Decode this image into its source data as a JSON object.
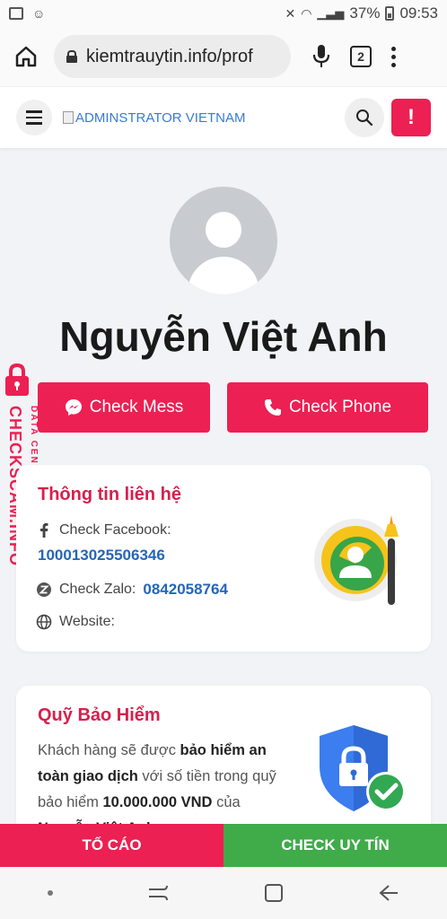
{
  "status_bar": {
    "battery": "37%",
    "time": "09:53"
  },
  "browser": {
    "url": "kiemtrauytin.info/prof",
    "tab_count": "2"
  },
  "header": {
    "logo_alt": "ADMINSTRATOR VIETNAM",
    "alert_label": "!"
  },
  "profile": {
    "name": "Nguyễn Việt Anh",
    "check_mess": "Check Mess",
    "check_phone": "Check Phone"
  },
  "watermark": {
    "brand": "CHECKSCAM.INFO",
    "sub": "DATA CENTER"
  },
  "contact": {
    "title": "Thông tin liên hệ",
    "facebook_label": "Check Facebook:",
    "facebook_id": "100013025506346",
    "zalo_label": "Check Zalo:",
    "zalo_value": "0842058764",
    "website_label": "Website:"
  },
  "insurance": {
    "title": "Quỹ Bảo Hiểm",
    "t1": "Khách hàng sẽ được ",
    "t2": "bảo hiểm an toàn giao dịch",
    "t3": " với số tiền trong quỹ bảo hiểm ",
    "t4": "10.000.000 VND",
    "t5": " của ",
    "t6": "Nguyễn Việt Anh"
  },
  "actions": {
    "report": "TỐ CÁO",
    "check": "CHECK UY TÍN"
  },
  "colors": {
    "primary": "#ec2052",
    "success": "#3fab49",
    "link": "#2466b8"
  }
}
